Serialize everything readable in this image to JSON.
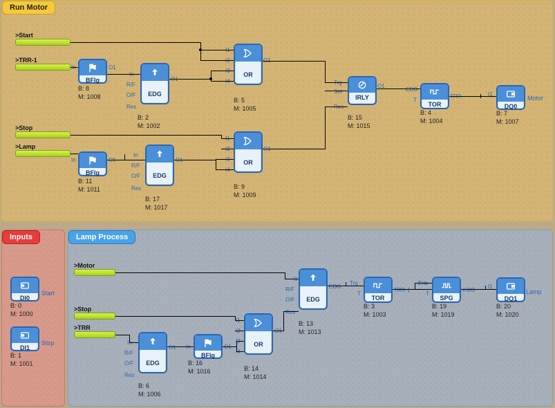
{
  "regions": {
    "run_motor": "Run Motor",
    "inputs": "Inputs",
    "lamp": "Lamp Process"
  },
  "signals": {
    "start": ">Start",
    "trr1": ">TRR-1",
    "stop": ">Stop",
    "lamp": ">Lamp",
    "motor": ">Motor",
    "stop2": ">Stop",
    "trr": ">TRR"
  },
  "blocks": {
    "bflg1": {
      "label": "BFlg",
      "b": "B: 8",
      "m": "M: 1008"
    },
    "edg1": {
      "label": "EDG",
      "b": "B: 2",
      "m": "M: 1002"
    },
    "or1": {
      "label": "OR",
      "b": "B: 5",
      "m": "M: 1005"
    },
    "irly": {
      "label": "IRLY",
      "b": "B: 15",
      "m": "M: 1015"
    },
    "tor1": {
      "label": "TOR",
      "b": "B: 4",
      "m": "M: 1004"
    },
    "dq0": {
      "label": "DQ0",
      "b": "B: 7",
      "m": "M: 1007"
    },
    "bflg2": {
      "label": "BFlg",
      "b": "B: 11",
      "m": "M: 1011"
    },
    "edg2": {
      "label": "EDG",
      "b": "B: 17",
      "m": "M: 1017"
    },
    "or2": {
      "label": "OR",
      "b": "B: 9",
      "m": "M: 1009"
    },
    "di0": {
      "label": "DI0",
      "b": "B: 0",
      "m": "M: 1000"
    },
    "di1": {
      "label": "DI1",
      "b": "B: 1",
      "m": "M: 1001"
    },
    "edg3": {
      "label": "EDG",
      "b": "B: 13",
      "m": "M: 1013"
    },
    "tor2": {
      "label": "TOR",
      "b": "B: 3",
      "m": "M: 1003"
    },
    "spg": {
      "label": "SPG",
      "b": "B: 19",
      "m": "M: 1019"
    },
    "dq1": {
      "label": "DQ1",
      "b": "B: 20",
      "m": "M: 1020"
    },
    "edg4": {
      "label": "EDG",
      "b": "B: 6",
      "m": "M: 1006"
    },
    "bflg3": {
      "label": "BFlg",
      "b": "B: 16",
      "m": "M: 1016"
    },
    "or3": {
      "label": "OR",
      "b": "B: 14",
      "m": "M: 1014"
    }
  },
  "ports": {
    "in": "In",
    "i1": "I1",
    "i2": "I2",
    "i3": "I3",
    "i4": "I4",
    "o1": "O1",
    "rf": "R/F",
    "of": "O/F",
    "res": "Res",
    "trg": "Trg",
    "set": "Set",
    "edg": "EDG",
    "trr": "TRR",
    "trr1": "TRR-1",
    "enb": "Enb",
    "t": "T",
    "sig": "#SIG",
    "motor": "Motor",
    "start": "Start",
    "stop": "Stop",
    "lamp": "Lamp"
  }
}
